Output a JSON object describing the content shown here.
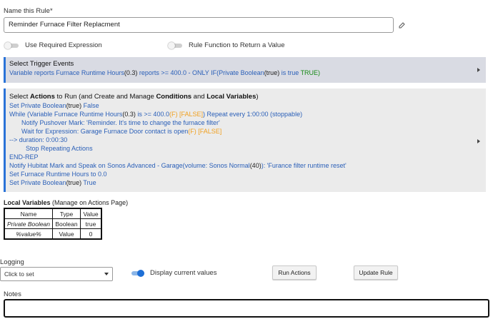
{
  "rule_name": {
    "label": "Name this Rule*",
    "value": "Reminder Furnace Filter Replacment"
  },
  "toggles": {
    "required_expression": {
      "label": "Use Required Expression",
      "on": false
    },
    "rule_function": {
      "label": "Rule Function to Return a Value",
      "on": false
    }
  },
  "trigger": {
    "title": "Select Trigger Events",
    "text_1": "Variable reports Furnace Runtime Hours",
    "text_2": "(0.3)",
    "text_3": " reports >= 400.0 - ONLY IF(Private Boolean",
    "text_4": "(true)",
    "text_5": " is true ",
    "text_6": "TRUE)"
  },
  "actions": {
    "title_1": "Select ",
    "title_2": "Actions",
    "title_3": " to Run (and Create and Manage ",
    "title_4": "Conditions",
    "title_5": " and ",
    "title_6": "Local Variables",
    "title_7": ")",
    "l1_a": "Set Private Boolean",
    "l1_b": "(true)",
    "l1_c": " False",
    "l2_a": "While (Variable Furnace Runtime Hours",
    "l2_b": "(0.3)",
    "l2_c": " is >= 400.0",
    "l2_d": "(F) [FALSE]",
    "l2_e": ") Repeat every 1:00:00 (stoppable)",
    "l3": "Notify Pushover Mark: 'Reminder. It's time to change the furnace filter'",
    "l4_a": "Wait for Expression: Garage Furnace Door contact is open",
    "l4_b": "(F) [FALSE]",
    "l5": "--> duration: 0:00:30",
    "l6": "Stop Repeating Actions",
    "l7": "END-REP",
    "l8_a": "Notify Hubitat Mark and Speak on Sonos Advanced - Garage(volume: Sonos Normal",
    "l8_b": "(40)",
    "l8_c": "): 'Furance filter runtime reset'",
    "l9": "Set Furnace Runtime Hours to 0.0",
    "l10_a": "Set Private Boolean",
    "l10_b": "(true)",
    "l10_c": " True"
  },
  "local_variables": {
    "title": "Local Variables",
    "subtitle": " (Manage on Actions Page)",
    "headers": [
      "Name",
      "Type",
      "Value"
    ],
    "rows": [
      [
        "Private Boolean",
        "Boolean",
        "true"
      ],
      [
        "%value%",
        "Value",
        "0"
      ]
    ]
  },
  "logging": {
    "label": "Logging",
    "select_value": "Click to set",
    "display_toggle": {
      "label": "Display current values",
      "on": true
    }
  },
  "buttons": {
    "run_actions": "Run Actions",
    "update_rule": "Update Rule"
  },
  "notes": {
    "label": "Notes",
    "value": ""
  },
  "colors": {
    "accent": "#2a73d8",
    "link": "#2a5fb8",
    "false": "#f0a020",
    "true": "#178a17"
  }
}
